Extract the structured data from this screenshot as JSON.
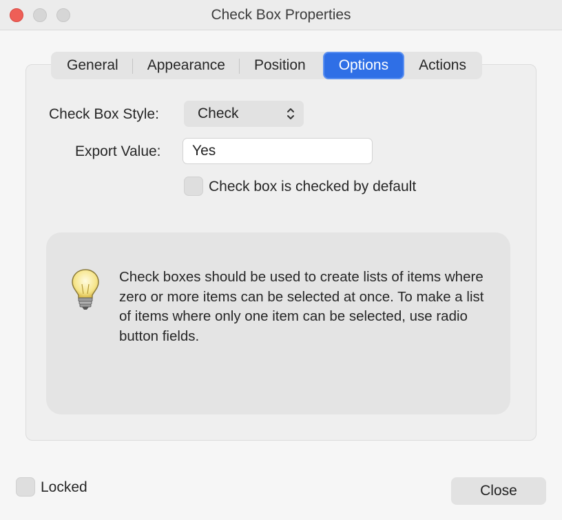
{
  "window": {
    "title": "Check Box Properties"
  },
  "tabs": [
    {
      "label": "General"
    },
    {
      "label": "Appearance"
    },
    {
      "label": "Position"
    },
    {
      "label": "Options"
    },
    {
      "label": "Actions"
    }
  ],
  "active_tab": "Options",
  "form": {
    "style_label": "Check Box Style:",
    "style_value": "Check",
    "export_label": "Export Value:",
    "export_value": "Yes",
    "default_checked_label": "Check box is checked by default"
  },
  "info": {
    "icon": "lightbulb-icon",
    "text": "Check boxes should be used to create lists of items where zero or more items can be selected at once. To make a list of items where only one item can be selected, use radio button fields."
  },
  "footer": {
    "locked_label": "Locked",
    "close_label": "Close"
  },
  "colors": {
    "accent": "#2f6fe6",
    "close_light": "#ee5f57"
  }
}
